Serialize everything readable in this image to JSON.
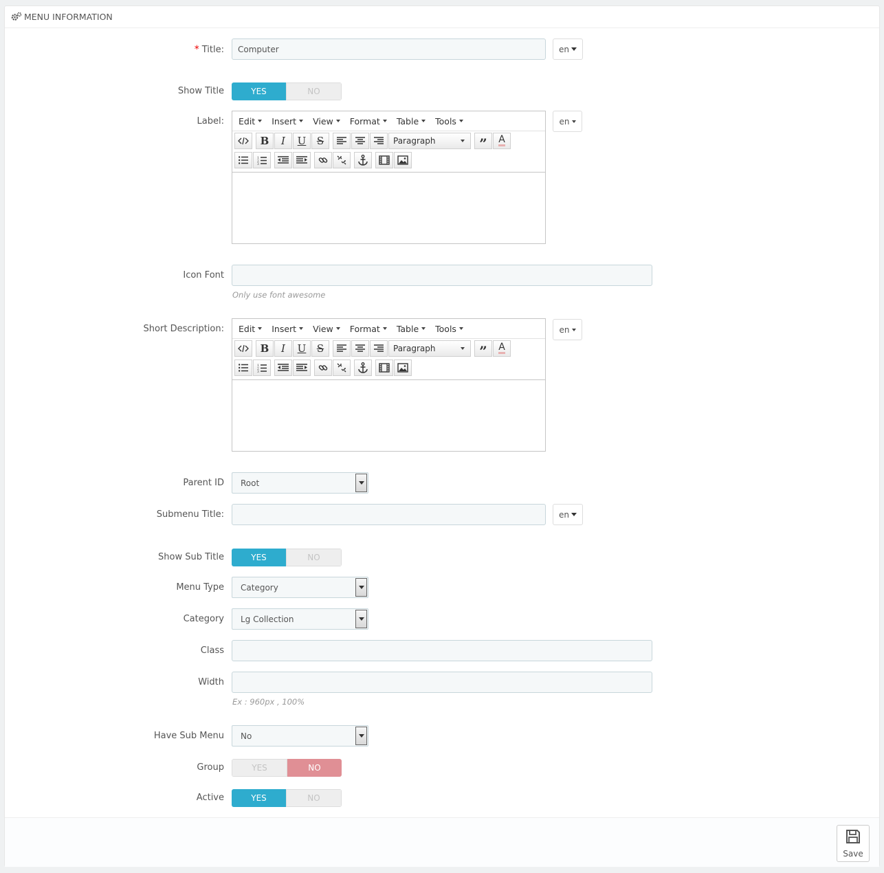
{
  "panel": {
    "title": "MENU INFORMATION"
  },
  "fields": {
    "title": {
      "label": "Title:",
      "required_mark": "*",
      "value": "Computer",
      "lang": "en"
    },
    "show_title": {
      "label": "Show Title",
      "yes": "YES",
      "no": "NO",
      "selected": "YES"
    },
    "label": {
      "label": "Label:",
      "lang": "en"
    },
    "icon_font": {
      "label": "Icon Font",
      "value": "",
      "help": "Only use font awesome"
    },
    "short_description": {
      "label": "Short Description:",
      "lang": "en"
    },
    "parent_id": {
      "label": "Parent ID",
      "value": "Root"
    },
    "submenu_title": {
      "label": "Submenu Title:",
      "value": "",
      "lang": "en"
    },
    "show_sub_title": {
      "label": "Show Sub Title",
      "yes": "YES",
      "no": "NO",
      "selected": "YES"
    },
    "menu_type": {
      "label": "Menu Type",
      "value": "Category"
    },
    "category": {
      "label": "Category",
      "value": "Lg Collection"
    },
    "class": {
      "label": "Class",
      "value": ""
    },
    "width": {
      "label": "Width",
      "value": "",
      "help": "Ex : 960px , 100%"
    },
    "have_sub_menu": {
      "label": "Have Sub Menu",
      "value": "No"
    },
    "group": {
      "label": "Group",
      "yes": "YES",
      "no": "NO",
      "selected": "NO"
    },
    "active": {
      "label": "Active",
      "yes": "YES",
      "no": "NO",
      "selected": "YES"
    }
  },
  "editor": {
    "menus": [
      "Edit",
      "Insert",
      "View",
      "Format",
      "Table",
      "Tools"
    ],
    "block_format": "Paragraph",
    "row1_icons": [
      "code-icon",
      "bold-icon",
      "italic-icon",
      "underline-icon",
      "strikethrough-icon",
      "align-left-icon",
      "align-center-icon",
      "align-right-icon",
      "blockquote-icon",
      "text-color-icon"
    ],
    "row2_icons": [
      "bullet-list-icon",
      "numbered-list-icon",
      "outdent-icon",
      "indent-icon",
      "link-icon",
      "unlink-icon",
      "anchor-icon",
      "media-icon",
      "image-icon"
    ]
  },
  "footer": {
    "save_label": "Save"
  },
  "colors": {
    "accent": "#2eacce",
    "danger": "#e08f95",
    "input_bg": "#f5f8f9"
  }
}
